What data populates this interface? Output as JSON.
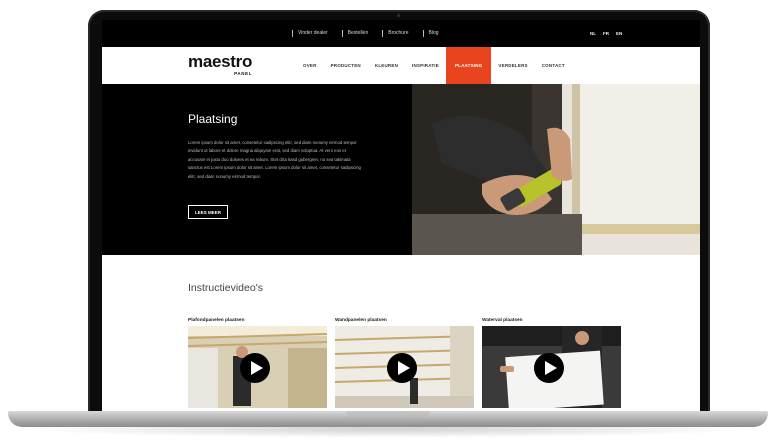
{
  "topbar": {
    "links": [
      "Vinder dealer",
      "Bestellen",
      "Brochure",
      "Blog"
    ],
    "languages": [
      "NL",
      "FR",
      "EN"
    ]
  },
  "navbar": {
    "logo_main": "maestro",
    "logo_sub": "PANEL",
    "menu": [
      {
        "label": "Over",
        "active": false
      },
      {
        "label": "Producten",
        "active": false
      },
      {
        "label": "Kleuren",
        "active": false
      },
      {
        "label": "Inspiratie",
        "active": false
      },
      {
        "label": "Plaatsing",
        "active": true
      },
      {
        "label": "Verdelers",
        "active": false
      },
      {
        "label": "Contact",
        "active": false
      }
    ]
  },
  "hero": {
    "title": "Plaatsing",
    "text": "Lorem ipsum dolor sit amet, consetetur sadipscing elitr, sed diam nonumy eirmod tempor invidunt ut labore et dolore magna aliquyam erat, sed diam voluptua. At vero eos et accusam et justo duo dolores et ea rebum. Stet clita kasd gubergren, no sea takimata sanctus est Lorem ipsum dolor sit amet. Lorem ipsum dolor sit amet, consetetur sadipscing elitr, sed diam nonumy eirmod tempor.",
    "button": "LEES MEER"
  },
  "videos": {
    "title": "Instructievideo's",
    "items": [
      {
        "label": "Plafondpanelen plaatsen"
      },
      {
        "label": "Wandpanelen plaatsen"
      },
      {
        "label": "Waterval plaatsen"
      }
    ]
  },
  "colors": {
    "accent": "#e8451e",
    "topbar": "#000000",
    "hero_bg": "#000000"
  }
}
